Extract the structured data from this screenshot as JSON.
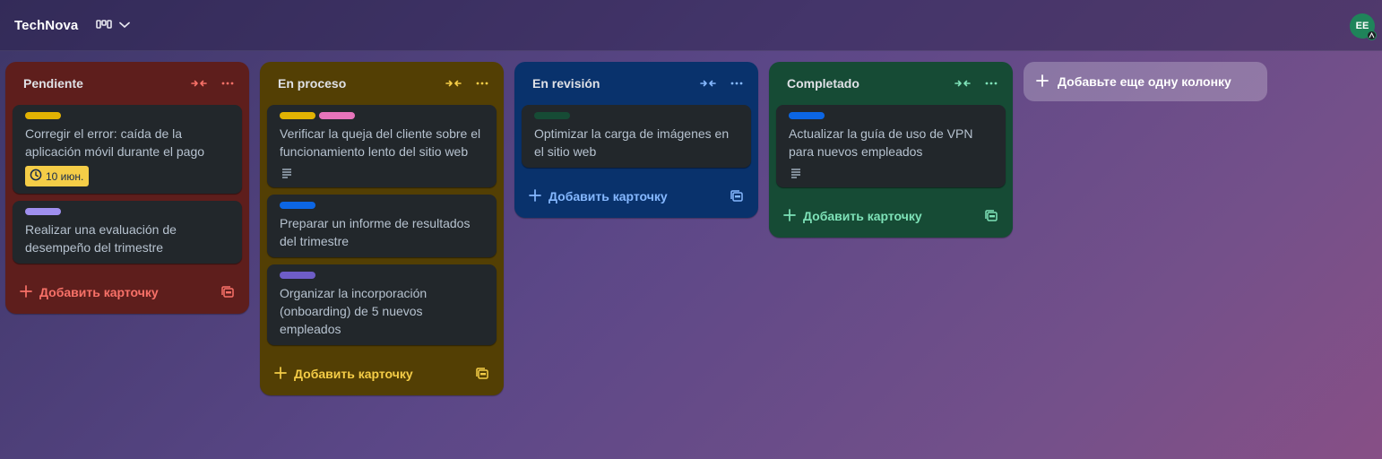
{
  "board": {
    "title": "TechNova",
    "user_initials": "EE"
  },
  "columns": [
    {
      "title": "Pendiente",
      "color": "#5e1e1c",
      "accent": "#f87168",
      "add_label": "Добавить карточку",
      "cards": [
        {
          "labels": [
            "#e2b203"
          ],
          "title": "Corregir el error: caída de la aplicación móvil durante el pago",
          "due": "10 июн.",
          "has_description": false
        },
        {
          "labels": [
            "#9f8fef"
          ],
          "title": "Realizar una evaluación de desempeño del trimestre",
          "has_description": false
        }
      ]
    },
    {
      "title": "En proceso",
      "color": "#533f04",
      "accent": "#f5cd47",
      "add_label": "Добавить карточку",
      "cards": [
        {
          "labels": [
            "#e2b203",
            "#e774bb"
          ],
          "title": "Verificar la queja del cliente sobre el funcionamiento lento del sitio web",
          "has_description": true
        },
        {
          "labels": [
            "#0c66e4"
          ],
          "title": "Preparar un informe de resultados del trimestre",
          "has_description": false
        },
        {
          "labels": [
            "#6e5dc6"
          ],
          "title": "Organizar la incorporación (onboarding) de 5 nuevos empleados",
          "has_description": false
        }
      ]
    },
    {
      "title": "En revisión",
      "color": "#09326c",
      "accent": "#85b8ff",
      "add_label": "Добавить карточку",
      "cards": [
        {
          "labels": [
            "#164b35"
          ],
          "title": "Optimizar la carga de imágenes en el sitio web",
          "has_description": false
        }
      ]
    },
    {
      "title": "Completado",
      "color": "#164b35",
      "accent": "#7ee2b8",
      "add_label": "Добавить карточку",
      "cards": [
        {
          "labels": [
            "#0c66e4"
          ],
          "title": "Actualizar la guía de uso de VPN para nuevos empleados",
          "has_description": true
        }
      ]
    }
  ],
  "add_column_label": "Добавьте еще одну колонку"
}
